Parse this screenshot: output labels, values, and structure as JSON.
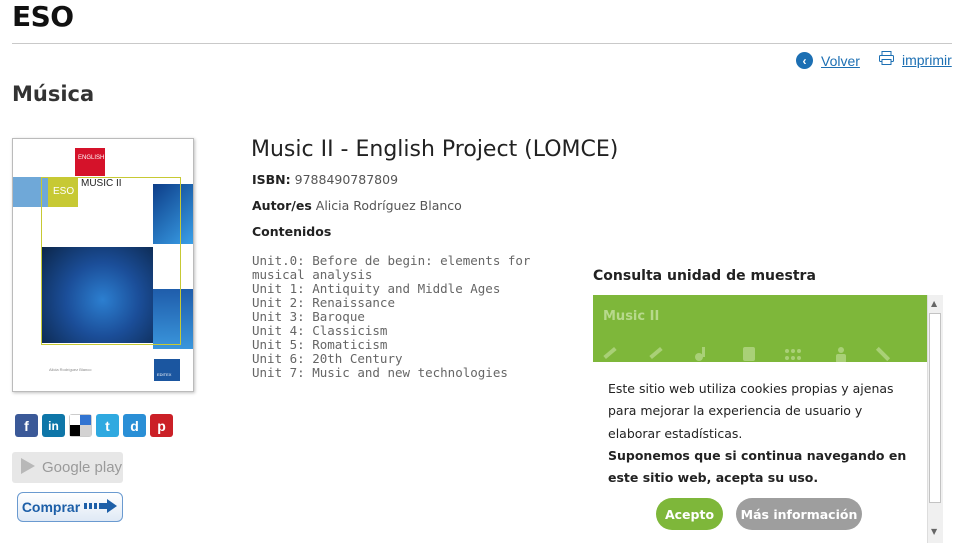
{
  "header": {
    "title": "ESO"
  },
  "nav": {
    "back_label": "Volver",
    "print_label": "imprimir"
  },
  "section": {
    "title": "Música"
  },
  "cover": {
    "tag_language": "ENGLISH",
    "tag_level": "ESO",
    "book_name": "MUSIC II",
    "author_small": "Alicia Rodríguez Blanco",
    "publisher": "EDITEX"
  },
  "product": {
    "title": "Music II - English Project (LOMCE)",
    "isbn_label": "ISBN:",
    "isbn": "9788490787809",
    "author_label": "Autor/es",
    "author": "Alicia Rodríguez Blanco",
    "contents_label": "Contenidos",
    "units": [
      "Unit.0: Before de begin: elements for musical analysis",
      "Unit 1: Antiquity and Middle Ages",
      "Unit 2: Renaissance",
      "Unit 3: Baroque",
      "Unit 4: Classicism",
      "Unit 5: Romaticism",
      "Unit 6: 20th Century",
      "Unit 7: Music and new technologies"
    ]
  },
  "social": [
    {
      "name": "facebook",
      "glyph": "f",
      "color": "#3b5998"
    },
    {
      "name": "linkedin",
      "glyph": "in",
      "color": "#0e76a8"
    },
    {
      "name": "delicious",
      "glyph": "",
      "color": "#ffffff"
    },
    {
      "name": "twitter",
      "glyph": "t",
      "color": "#2fa9e0"
    },
    {
      "name": "digg",
      "glyph": "d",
      "color": "#2a8fd6"
    },
    {
      "name": "pinterest",
      "glyph": "p",
      "color": "#cb2027"
    }
  ],
  "store": {
    "google_play": "Google play",
    "buy": "Comprar"
  },
  "muestra": {
    "title": "Consulta unidad de muestra",
    "banner_title": "Music II"
  },
  "cookie": {
    "text": "Este sitio web utiliza cookies propias y ajenas para mejorar la experiencia de usuario y elaborar estadísticas.",
    "text_bold": "Suponemos que si continua navegando en este sitio web, acepta su uso.",
    "accept": "Acepto",
    "more": "Más información"
  },
  "colors": {
    "link": "#1c6fb3",
    "accent_green": "#7eb73a",
    "button_grey": "#9e9e9e"
  }
}
